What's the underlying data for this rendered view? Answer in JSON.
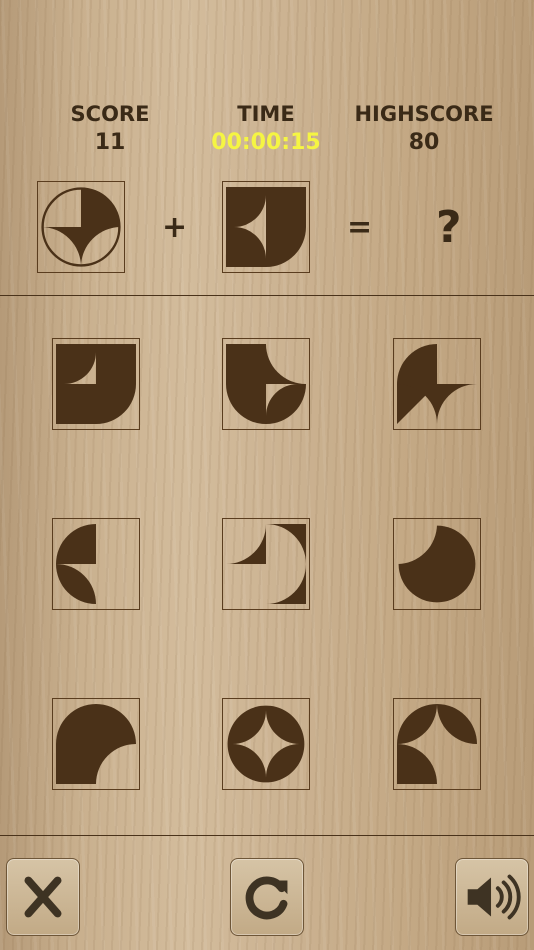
{
  "hud": {
    "score_label": "SCORE",
    "score_value": "11",
    "time_label": "TIME",
    "time_value": "00:00:15",
    "highscore_label": "HIGHSCORE",
    "highscore_value": "80"
  },
  "equation": {
    "plus": "+",
    "equals": "=",
    "unknown": "?"
  },
  "colors": {
    "ink": "#4a3118",
    "time_highlight": "#f5f543"
  },
  "buttons": {
    "close_icon": "close-icon",
    "restart_icon": "restart-icon",
    "sound_icon": "speaker-icon"
  }
}
